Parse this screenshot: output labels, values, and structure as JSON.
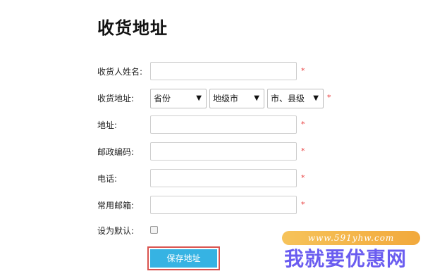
{
  "page": {
    "title": "收货地址"
  },
  "form": {
    "name_label": "收货人姓名:",
    "address_region_label": "收货地址:",
    "province_value": "省份",
    "city_value": "地级市",
    "district_value": "市、县级",
    "street_label": "地址:",
    "postcode_label": "邮政编码:",
    "phone_label": "电话:",
    "email_label": "常用邮箱:",
    "default_label": "设为默认:",
    "required_mark": "*",
    "save_label": "保存地址"
  },
  "watermark": {
    "url": "www.591yhw.com",
    "text": "我就要优惠网"
  },
  "colors": {
    "required": "#e83b3b",
    "button_bg": "#36b3e3",
    "button_border": "#d9534f"
  }
}
